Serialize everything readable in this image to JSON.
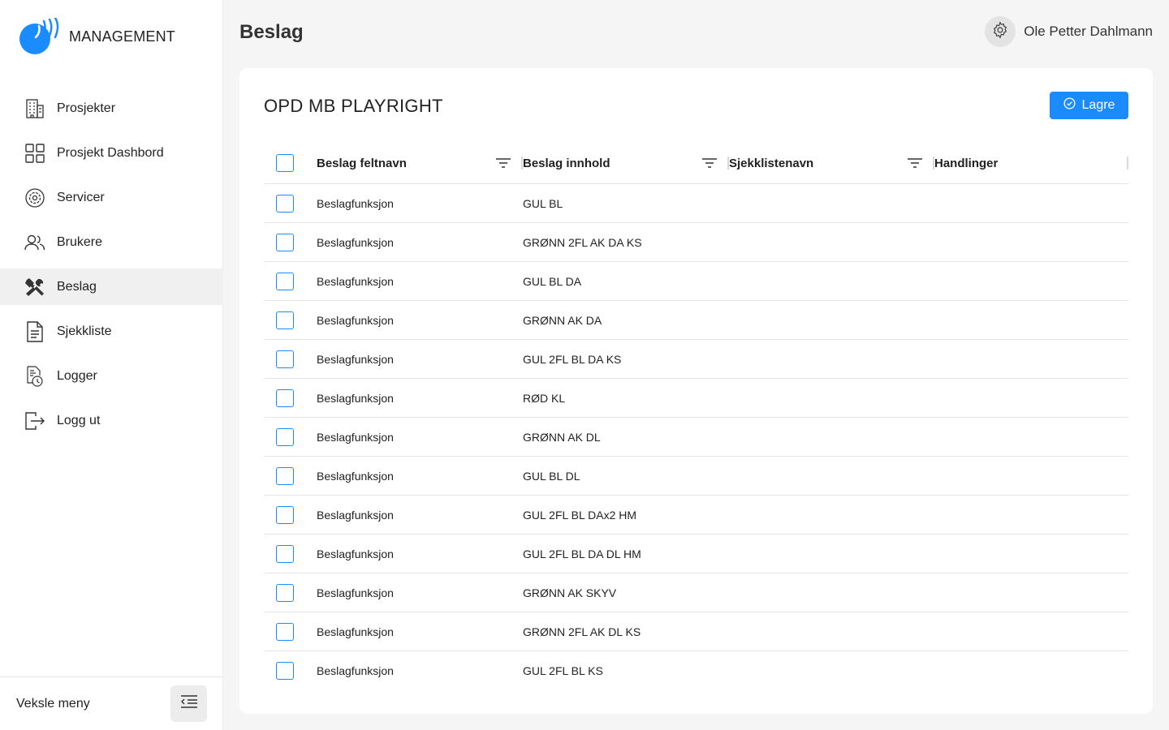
{
  "app": {
    "name": "MANAGEMENT"
  },
  "sidebar": {
    "items": [
      {
        "label": "Prosjekter",
        "icon": "building-icon",
        "active": false
      },
      {
        "label": "Prosjekt Dashbord",
        "icon": "grid-icon",
        "active": false
      },
      {
        "label": "Servicer",
        "icon": "service-gear-icon",
        "active": false
      },
      {
        "label": "Brukere",
        "icon": "users-icon",
        "active": false
      },
      {
        "label": "Beslag",
        "icon": "tools-icon",
        "active": true
      },
      {
        "label": "Sjekkliste",
        "icon": "document-icon",
        "active": false
      },
      {
        "label": "Logger",
        "icon": "log-clock-icon",
        "active": false
      },
      {
        "label": "Logg ut",
        "icon": "logout-icon",
        "active": false
      }
    ],
    "footer_label": "Veksle meny"
  },
  "header": {
    "title": "Beslag",
    "user_name": "Ole Petter Dahlmann"
  },
  "card": {
    "title": "OPD MB PLAYRIGHT",
    "save_label": "Lagre"
  },
  "table": {
    "columns": [
      "Beslag feltnavn",
      "Beslag innhold",
      "Sjekklistenavn",
      "Handlinger"
    ],
    "rows": [
      [
        "Beslagfunksjon",
        "GUL BL",
        "",
        ""
      ],
      [
        "Beslagfunksjon",
        "GRØNN 2FL AK DA KS",
        "",
        ""
      ],
      [
        "Beslagfunksjon",
        "GUL BL DA",
        "",
        ""
      ],
      [
        "Beslagfunksjon",
        "GRØNN AK DA",
        "",
        ""
      ],
      [
        "Beslagfunksjon",
        "GUL 2FL BL DA KS",
        "",
        ""
      ],
      [
        "Beslagfunksjon",
        "RØD KL",
        "",
        ""
      ],
      [
        "Beslagfunksjon",
        "GRØNN AK DL",
        "",
        ""
      ],
      [
        "Beslagfunksjon",
        "GUL BL DL",
        "",
        ""
      ],
      [
        "Beslagfunksjon",
        "GUL 2FL BL DAx2 HM",
        "",
        ""
      ],
      [
        "Beslagfunksjon",
        "GUL 2FL BL DA DL HM",
        "",
        ""
      ],
      [
        "Beslagfunksjon",
        "GRØNN AK SKYV",
        "",
        ""
      ],
      [
        "Beslagfunksjon",
        "GRØNN 2FL AK DL KS",
        "",
        ""
      ],
      [
        "Beslagfunksjon",
        "GUL 2FL BL KS",
        "",
        ""
      ]
    ]
  },
  "colors": {
    "accent": "#1a8cff",
    "active_bg": "#f0f0f0",
    "page_bg": "#f5f5f5"
  }
}
